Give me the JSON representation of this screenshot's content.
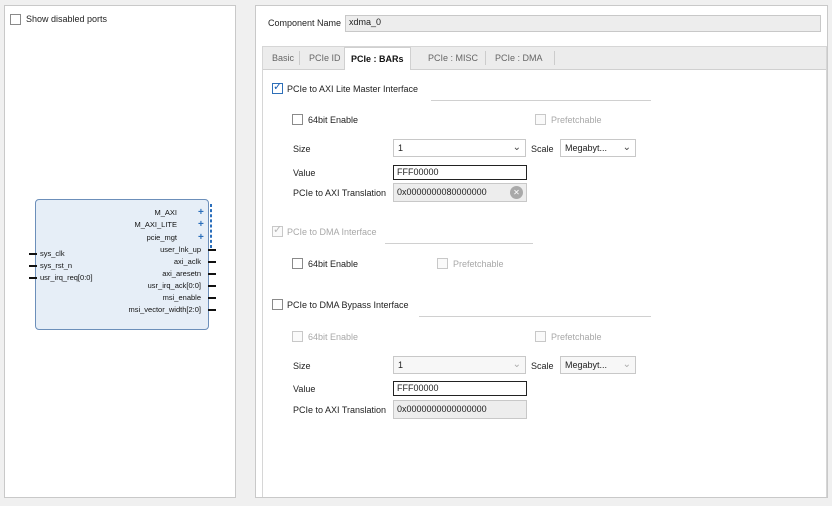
{
  "left": {
    "show_disabled_label": "Show disabled ports",
    "block": {
      "left_ports": [
        "sys_clk",
        "sys_rst_n",
        "usr_irq_req[0:0]"
      ],
      "right_ports": [
        "M_AXI",
        "M_AXI_LITE",
        "pcie_mgt",
        "user_lnk_up",
        "axi_aclk",
        "axi_aresetn",
        "usr_irq_ack[0:0]",
        "msi_enable",
        "msi_vector_width[2:0]"
      ]
    }
  },
  "right": {
    "component_name_label": "Component Name",
    "component_name_value": "xdma_0",
    "tabs": [
      "Basic",
      "PCIe ID",
      "PCIe : BARs",
      "PCIe : MISC",
      "PCIe : DMA"
    ],
    "active_tab": "PCIe : BARs",
    "sec1": {
      "title": "PCIe to AXI Lite Master Interface",
      "bit64": "64bit Enable",
      "prefetch": "Prefetchable",
      "size_label": "Size",
      "size_value": "1",
      "scale_label": "Scale",
      "scale_value": "Megabyt...",
      "value_label": "Value",
      "value_value": "FFF00000",
      "trans_label": "PCIe to AXI Translation",
      "trans_value": "0x0000000080000000"
    },
    "sec2": {
      "title": "PCIe to DMA Interface",
      "bit64": "64bit Enable",
      "prefetch": "Prefetchable"
    },
    "sec3": {
      "title": "PCIe to DMA Bypass Interface",
      "bit64": "64bit Enable",
      "prefetch": "Prefetchable",
      "size_label": "Size",
      "size_value": "1",
      "scale_label": "Scale",
      "scale_value": "Megabyt...",
      "value_label": "Value",
      "value_value": "FFF00000",
      "trans_label": "PCIe to AXI Translation",
      "trans_value": "0x0000000000000000"
    }
  },
  "icons": {
    "check": "✓",
    "chevron": "⌄",
    "clear": "✕",
    "plus": "+"
  }
}
